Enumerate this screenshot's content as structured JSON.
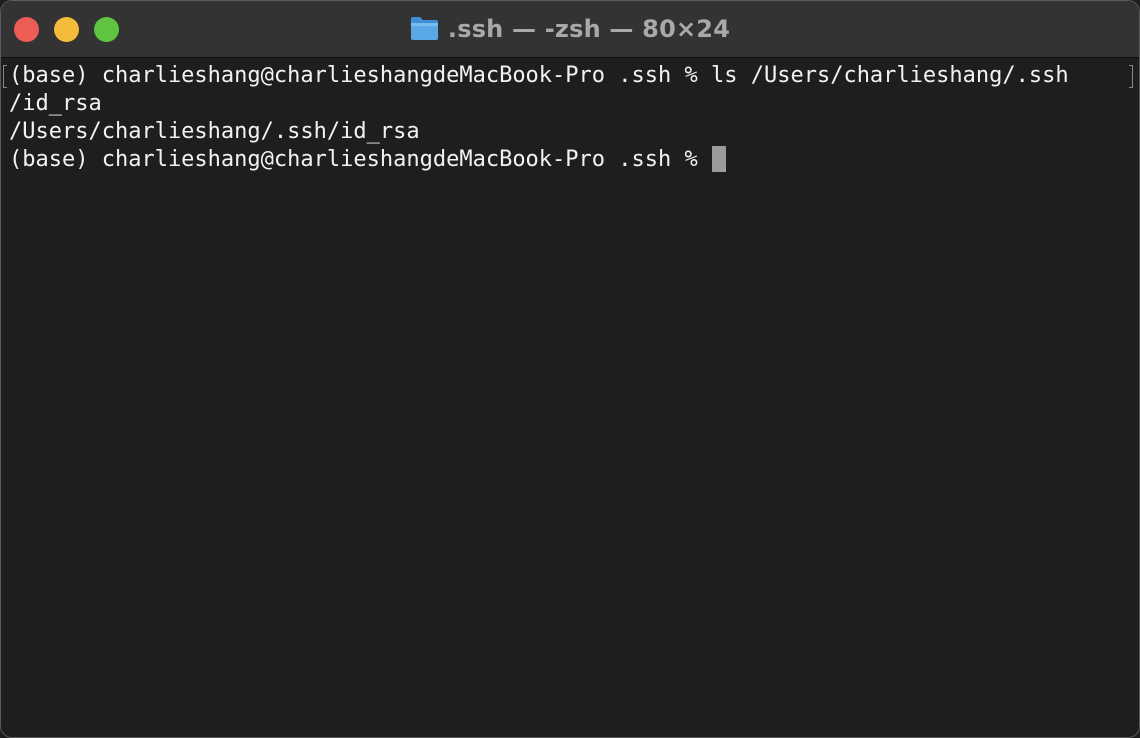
{
  "window": {
    "title": ".ssh — -zsh — 80×24",
    "title_icon": "folder-icon",
    "controls": [
      "close-button",
      "minimize-button",
      "zoom-button"
    ]
  },
  "terminal": {
    "line1": "(base) charlieshang@charlieshangdeMacBook-Pro .ssh % ls /Users/charlieshang/.ssh",
    "line2": "/id_rsa",
    "line3": "/Users/charlieshang/.ssh/id_rsa",
    "prompt": "(base) charlieshang@charlieshangdeMacBook-Pro .ssh % "
  },
  "colors": {
    "background": "#1e1e1e",
    "titlebar": "#333333",
    "text": "#f2f2f2",
    "title_text": "#a9a9a9",
    "cursor": "#9c9c9c",
    "close": "#ee5d55",
    "minimize": "#f5bb3b",
    "zoom": "#5fc440",
    "folder": "#5aa9e6"
  }
}
